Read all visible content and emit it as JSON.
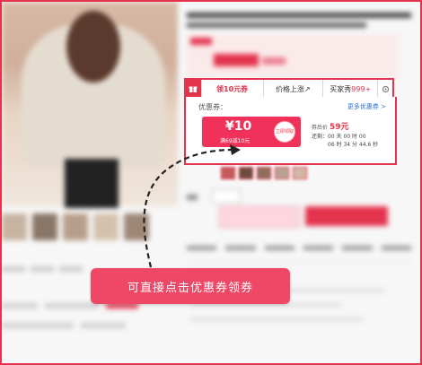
{
  "coupon_tabs": {
    "gift_icon": "gift-icon",
    "coupon_tab": "领10元券",
    "price_tab": "价格上涨↗",
    "buyer_tab_prefix": "买家秀 ",
    "buyer_tab_count": "999+",
    "settings_icon": "gear-icon"
  },
  "coupon_panel": {
    "title": "优惠券：",
    "more_link": "更多优惠券 >",
    "coupon_amount": "¥10",
    "coupon_condition": "满69减10元",
    "stamp_text": "立即领取",
    "after_coupon_label": "券后价",
    "after_coupon_price": "59元",
    "countdown_label": "还剩：",
    "countdown_line1": "00 天 00 时 00",
    "countdown_line2": "06 时 34 分 44.6 秒"
  },
  "callout": {
    "text": "可直接点击优惠券领券"
  },
  "colors": {
    "accent": "#e3334d",
    "callout_bg": "#ef4866",
    "link": "#2f6fd4"
  }
}
